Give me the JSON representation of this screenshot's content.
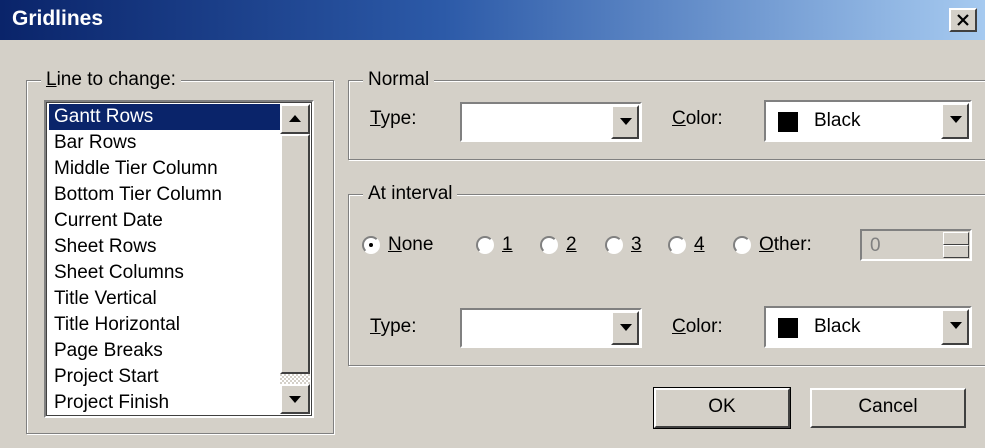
{
  "window": {
    "title": "Gridlines"
  },
  "line_to_change": {
    "label_accel": "L",
    "label_rest": "ine to change:",
    "items": [
      "Gantt Rows",
      "Bar Rows",
      "Middle Tier Column",
      "Bottom Tier Column",
      "Current Date",
      "Sheet Rows",
      "Sheet Columns",
      "Title Vertical",
      "Title Horizontal",
      "Page Breaks",
      "Project Start",
      "Project Finish"
    ],
    "selected": "Gantt Rows"
  },
  "normal": {
    "legend": "Normal",
    "type_accel": "T",
    "type_rest": "ype:",
    "type_value": "",
    "color_accel": "C",
    "color_rest": "olor:",
    "color_value": "Black",
    "color_swatch": "#000000"
  },
  "at_interval": {
    "legend": "At interval",
    "options": [
      {
        "accel": "N",
        "rest": "one",
        "checked": true
      },
      {
        "accel": "1",
        "rest": "",
        "checked": false
      },
      {
        "accel": "2",
        "rest": "",
        "checked": false
      },
      {
        "accel": "3",
        "rest": "",
        "checked": false
      },
      {
        "accel": "4",
        "rest": "",
        "checked": false
      },
      {
        "accel": "O",
        "rest": "ther:",
        "checked": false
      }
    ],
    "other_value": "0",
    "type_accel": "T",
    "type_rest": "ype:",
    "type_value": "",
    "color_accel": "C",
    "color_rest": "olor:",
    "color_value": "Black",
    "color_swatch": "#000000"
  },
  "buttons": {
    "ok": "OK",
    "cancel": "Cancel"
  },
  "colors": {
    "titlebar_start": "#0a246a",
    "titlebar_end": "#a6caf0",
    "dialog_bg": "#d4d0c8",
    "selection": "#0a246a"
  }
}
